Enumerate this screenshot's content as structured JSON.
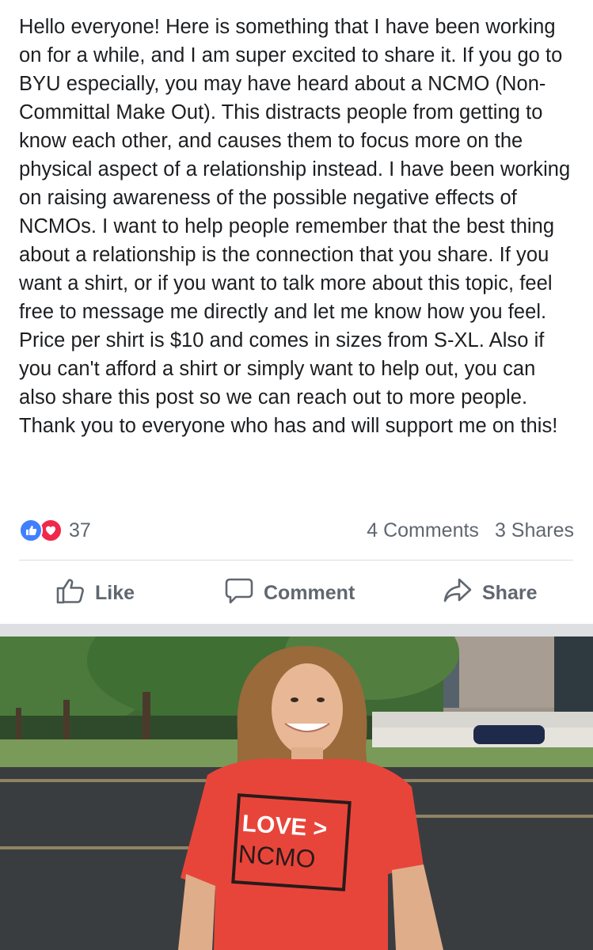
{
  "post": {
    "text": "Hello everyone! Here is something that I have been working on for a while, and I am super excited to share it. If you go to BYU especially, you may have heard about a NCMO (Non-Committal Make Out). This distracts people from getting to know each other, and causes them to focus more on the physical aspect of a relationship instead. I have been working on raising awareness of the possible negative effects of NCMOs. I want to help people remember that the best thing about a relationship is the connection that you share. If you want a shirt, or if you want to talk more about this topic, feel free to message me directly and let me know how you feel. Price per shirt is $10 and comes in sizes from S-XL. Also if you can't afford a shirt or simply want to help out, you can also share this post so we can reach out to more people. Thank you to everyone who has and will support me on this!"
  },
  "stats": {
    "reaction_count": "37",
    "comments": "4 Comments",
    "shares": "3 Shares",
    "reactions": [
      "like-reaction-icon",
      "love-reaction-icon"
    ]
  },
  "actions": {
    "like_label": "Like",
    "comment_label": "Comment",
    "share_label": "Share"
  },
  "photo": {
    "shirt_line1": "LOVE >",
    "shirt_line2": "NCMO"
  },
  "colors": {
    "text": "#1c1e21",
    "muted": "#606770",
    "like_blue": "#4080ff",
    "love_red": "#f0284a",
    "shirt_red": "#e8453a",
    "divider": "#dadde1"
  }
}
